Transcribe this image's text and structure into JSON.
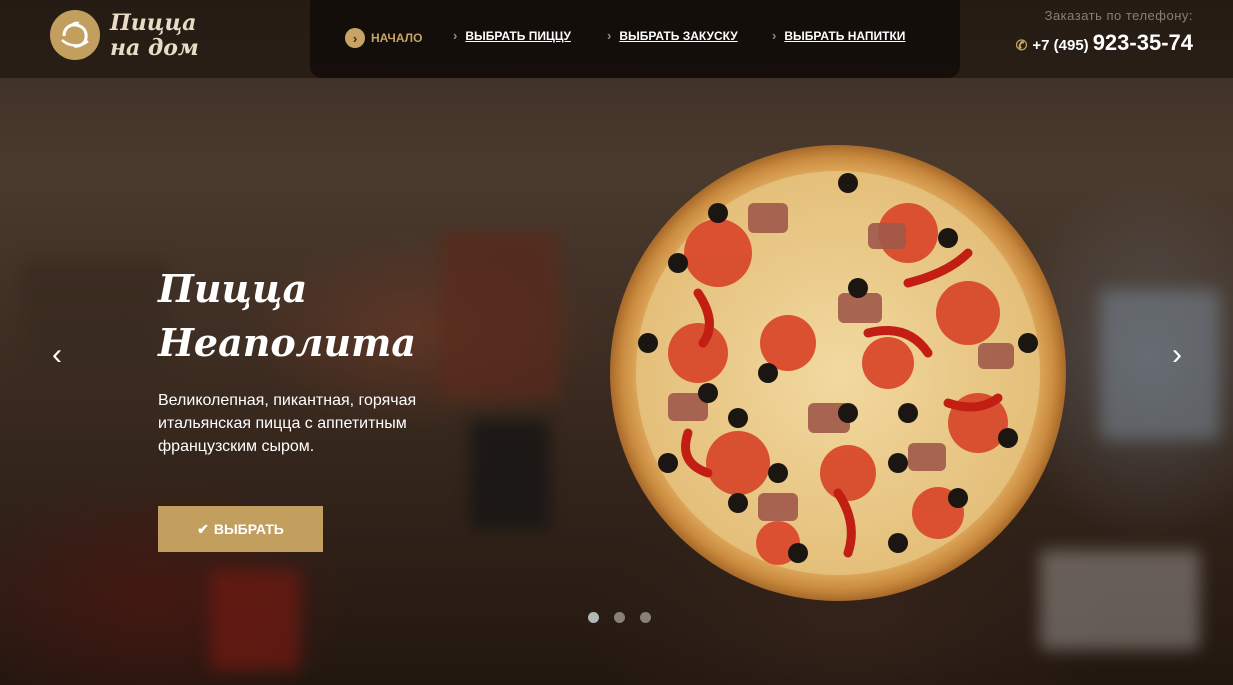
{
  "brand": {
    "line1": "Пицца",
    "line2": "на дом"
  },
  "nav": {
    "items": [
      {
        "label": "НАЧАЛО",
        "active": true
      },
      {
        "label": "ВЫБРАТЬ ПИЦЦУ",
        "active": false
      },
      {
        "label": "ВЫБРАТЬ ЗАКУСКУ",
        "active": false
      },
      {
        "label": "ВЫБРАТЬ НАПИТКИ",
        "active": false
      }
    ]
  },
  "contact": {
    "label": "Заказать по телефону:",
    "prefix": "+7 (495)",
    "number": "923-35-74"
  },
  "slide": {
    "title_line1": "Пицца",
    "title_line2": "Неаполита",
    "description": "Великолепная, пикантная, горячая итальянская пицца с аппетитным французским сыром.",
    "button": "ВЫБРАТЬ"
  },
  "slider": {
    "count": 3,
    "active_index": 0
  },
  "icons": {
    "prev": "chevron-left-icon",
    "next": "chevron-right-icon",
    "phone": "phone-icon",
    "check": "check-icon",
    "logo": "tomato-logo-icon"
  },
  "colors": {
    "accent": "#c29f5e",
    "topbar": "#140e0a",
    "text": "#ffffff"
  }
}
